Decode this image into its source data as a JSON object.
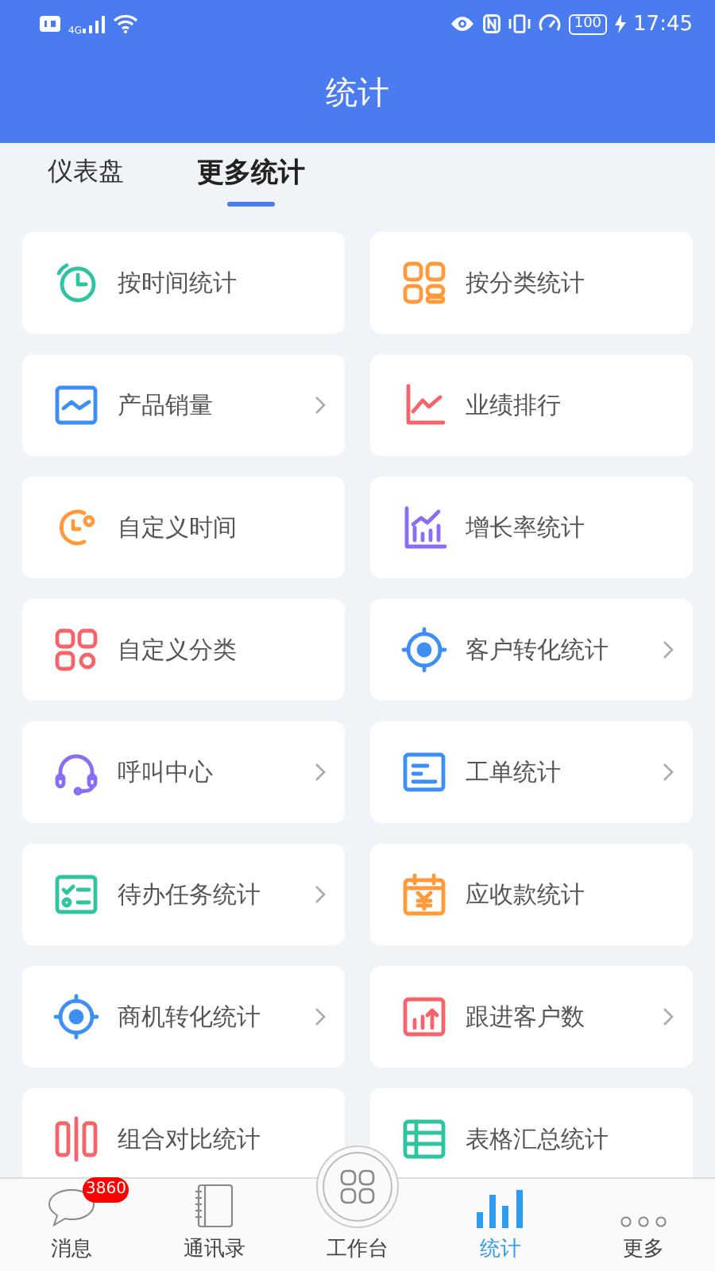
{
  "status_bar": {
    "network": "4G",
    "battery": "100",
    "time": "17:45"
  },
  "header": {
    "title": "统计"
  },
  "tabs": [
    {
      "label": "仪表盘",
      "selected": false
    },
    {
      "label": "更多统计",
      "selected": true
    }
  ],
  "items": [
    {
      "label": "按时间统计",
      "has_arrow": false
    },
    {
      "label": "按分类统计",
      "has_arrow": false
    },
    {
      "label": "产品销量",
      "has_arrow": true
    },
    {
      "label": "业绩排行",
      "has_arrow": false
    },
    {
      "label": "自定义时间",
      "has_arrow": false
    },
    {
      "label": "增长率统计",
      "has_arrow": false
    },
    {
      "label": "自定义分类",
      "has_arrow": false
    },
    {
      "label": "客户转化统计",
      "has_arrow": true
    },
    {
      "label": "呼叫中心",
      "has_arrow": true
    },
    {
      "label": "工单统计",
      "has_arrow": true
    },
    {
      "label": "待办任务统计",
      "has_arrow": true
    },
    {
      "label": "应收款统计",
      "has_arrow": false
    },
    {
      "label": "商机转化统计",
      "has_arrow": true
    },
    {
      "label": "跟进客户数",
      "has_arrow": true
    },
    {
      "label": "组合对比统计",
      "has_arrow": false
    },
    {
      "label": "表格汇总统计",
      "has_arrow": false
    }
  ],
  "nav": [
    {
      "label": "消息",
      "badge": "3860",
      "selected": false
    },
    {
      "label": "通讯录",
      "selected": false
    },
    {
      "label": "工作台",
      "selected": false
    },
    {
      "label": "统计",
      "selected": true
    },
    {
      "label": "更多",
      "selected": false
    }
  ]
}
